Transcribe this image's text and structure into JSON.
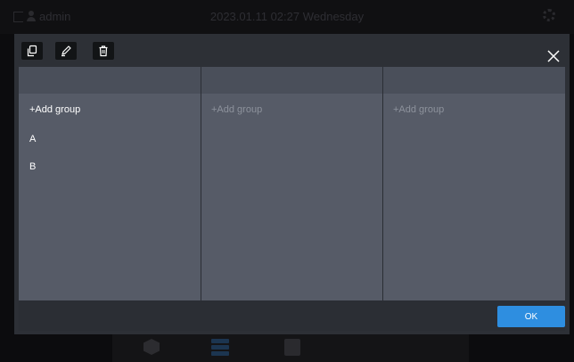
{
  "statusbar": {
    "user": "admin",
    "datetime": "2023.01.11 02:27 Wednesday"
  },
  "dialog": {
    "columns": [
      {
        "add_label": "+Add group",
        "items": [
          "A",
          "B"
        ]
      },
      {
        "add_label": "+Add group",
        "items": []
      },
      {
        "add_label": "+Add group",
        "items": []
      }
    ],
    "close_glyph": "×",
    "ok_label": "OK"
  },
  "icons": {
    "toolbar": [
      "copy-icon",
      "edit-icon",
      "delete-icon"
    ],
    "close": "close-icon"
  },
  "colors": {
    "accent": "#2e8ee0",
    "panel": "#565b67",
    "column_header": "#4a4f5a",
    "dialog_bg": "#2d3036"
  }
}
